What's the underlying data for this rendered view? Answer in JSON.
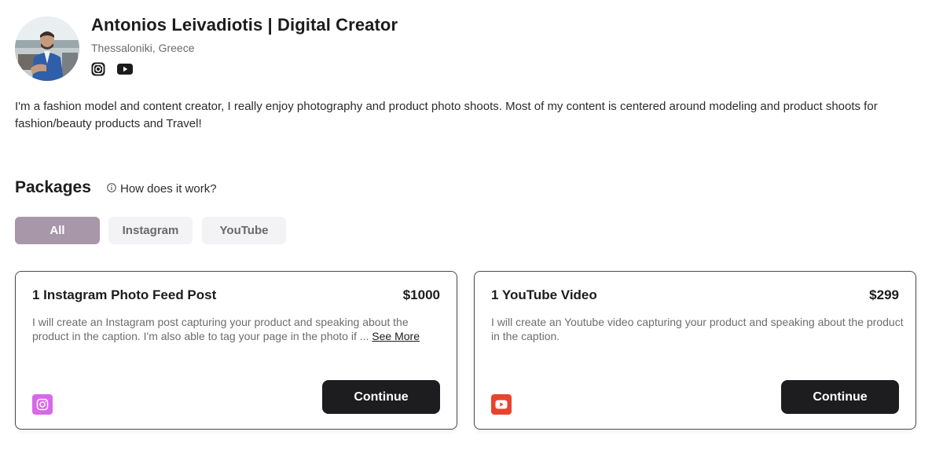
{
  "profile": {
    "name": "Antonios Leivadiotis | Digital Creator",
    "location": "Thessaloniki, Greece",
    "socials": [
      "instagram-icon",
      "youtube-icon"
    ],
    "bio": "I'm a fashion model and content creator, I really enjoy photography and product photo shoots. Most of my content is centered around modeling and product shoots for fashion/beauty products and Travel!"
  },
  "packages": {
    "title": "Packages",
    "how_label": "How does it work?",
    "filters": [
      {
        "label": "All",
        "active": true
      },
      {
        "label": "Instagram",
        "active": false
      },
      {
        "label": "YouTube",
        "active": false
      }
    ],
    "items": [
      {
        "title": "1 Instagram Photo Feed Post",
        "price": "$1000",
        "description": "I will create an Instagram post capturing your product and speaking about the product in the caption. I'm also able to tag your page in the photo if ...",
        "see_more": "See More",
        "platform": "instagram",
        "button": "Continue"
      },
      {
        "title": "1 YouTube Video",
        "price": "$299",
        "description": "I will create an Youtube video capturing your product and speaking about the product in the caption.",
        "platform": "youtube",
        "button": "Continue"
      }
    ]
  },
  "colors": {
    "tab_active": "#a896a9",
    "tab_inactive": "#f3f2f4",
    "button": "#1d1d1f",
    "instagram": "#d768e9",
    "youtube": "#e8432e"
  }
}
